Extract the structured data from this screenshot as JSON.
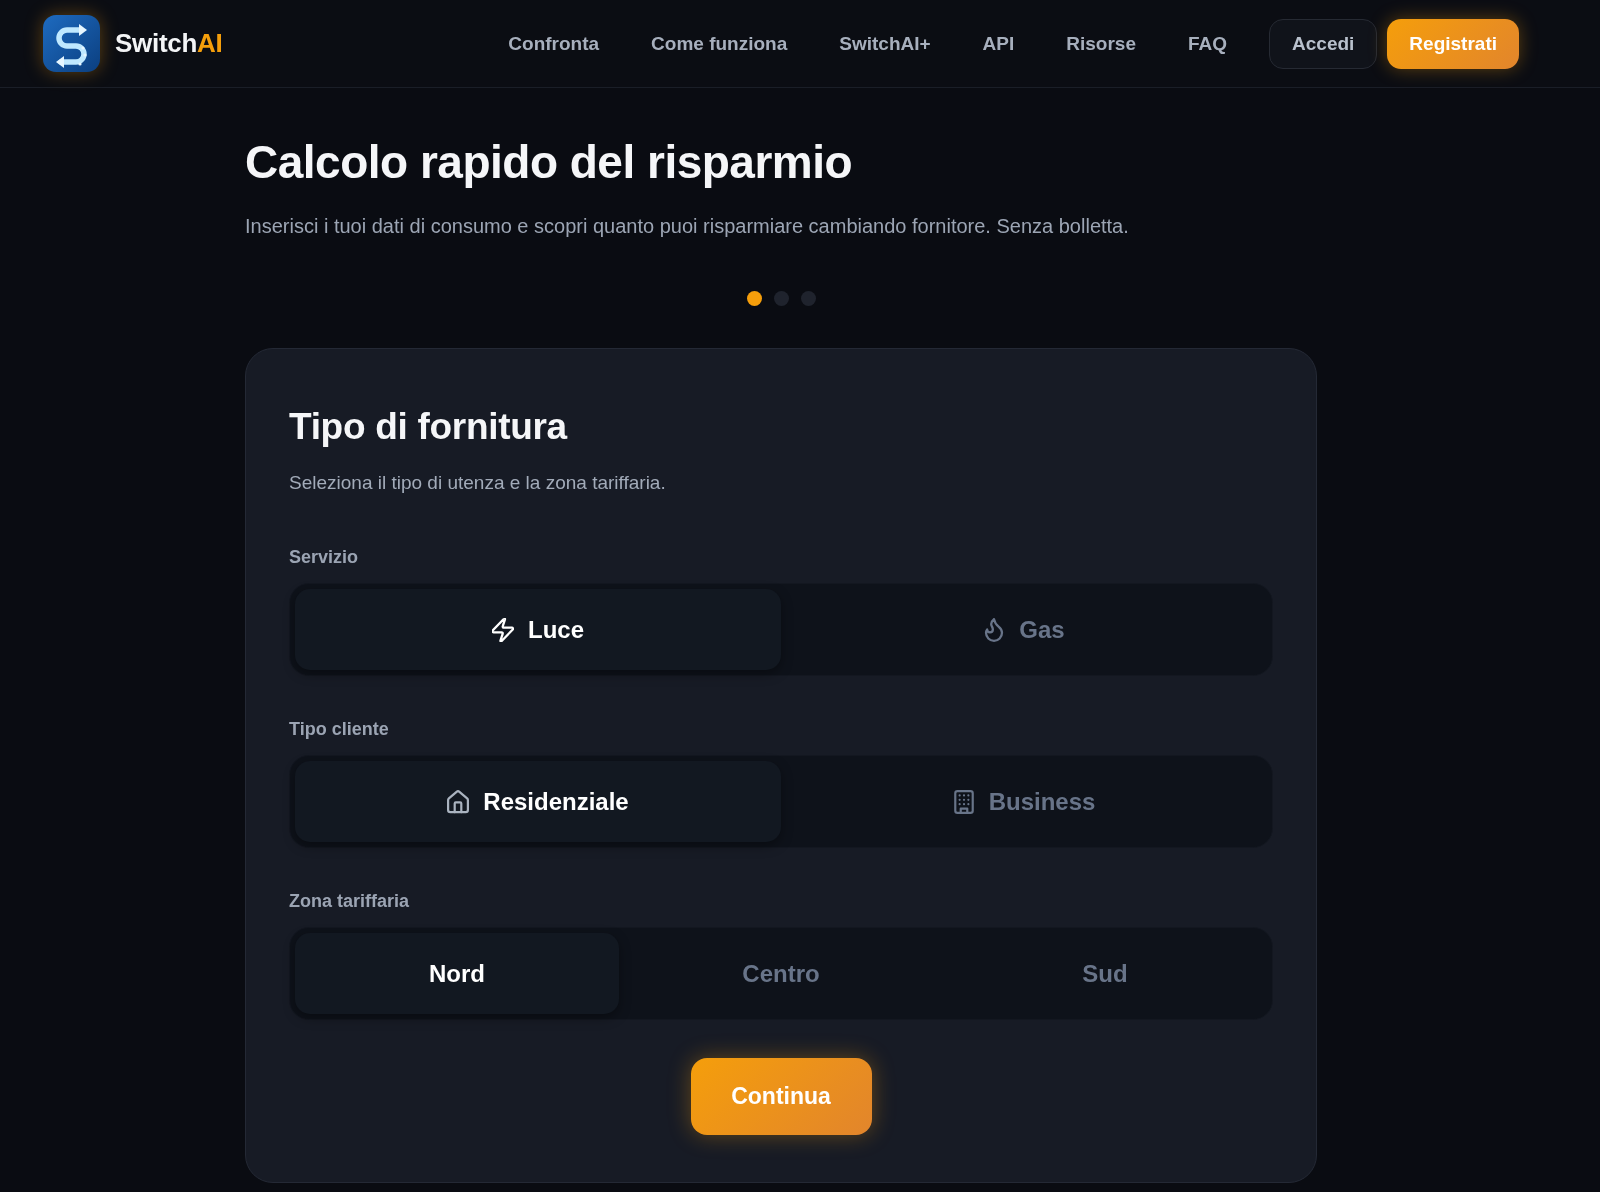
{
  "header": {
    "brand": {
      "text": "Switch",
      "accent": "AI"
    },
    "nav": [
      "Confronta",
      "Come funziona",
      "SwitchAI+",
      "API",
      "Risorse",
      "FAQ"
    ],
    "login_button": "Accedi",
    "signup_button": "Registrati"
  },
  "hero": {
    "title": "Calcolo rapido del risparmio",
    "subtitle": "Inserisci i tuoi dati di consumo e scopri quanto puoi risparmiare cambiando fornitore. Senza bolletta."
  },
  "steps": [
    {
      "selected": true
    },
    {
      "selected": false
    },
    {
      "selected": false
    }
  ],
  "form": {
    "title": "Tipo di fornitura",
    "subtitle": "Seleziona il tipo di utenza e la zona tariffaria.",
    "groups": [
      {
        "label": "Servizio",
        "options": [
          {
            "label": "Luce",
            "kind": "bolt",
            "selected": true
          },
          {
            "label": "Gas",
            "kind": "flame",
            "selected": false
          }
        ]
      },
      {
        "label": "Tipo cliente",
        "options": [
          {
            "label": "Residenziale",
            "kind": "house",
            "selected": true
          },
          {
            "label": "Business",
            "kind": "building",
            "selected": false
          }
        ]
      },
      {
        "label": "Zona tariffaria",
        "options": [
          {
            "label": "Nord",
            "kind": "plain",
            "selected": true
          },
          {
            "label": "Centro",
            "kind": "plain",
            "selected": false
          },
          {
            "label": "Sud",
            "kind": "plain",
            "selected": false
          }
        ]
      }
    ],
    "submit": "Continua"
  }
}
